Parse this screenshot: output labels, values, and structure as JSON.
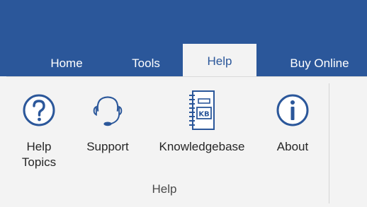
{
  "tabs": [
    {
      "label": "Home"
    },
    {
      "label": "Tools"
    },
    {
      "label": "Help",
      "active": true
    },
    {
      "label": "Buy Online"
    }
  ],
  "commands": {
    "help_topics": {
      "label_line1": "Help",
      "label_line2": "Topics",
      "icon": "question-circle-icon"
    },
    "support": {
      "label": "Support",
      "icon": "headset-icon"
    },
    "knowledgebase": {
      "label": "Knowledgebase",
      "icon_text": "KB",
      "icon": "kb-notebook-icon"
    },
    "about": {
      "label": "About",
      "icon": "info-circle-icon"
    }
  },
  "group": {
    "label": "Help"
  },
  "colors": {
    "ribbon": "#2b579a",
    "body": "#f3f3f3",
    "icon": "#2b579a"
  }
}
